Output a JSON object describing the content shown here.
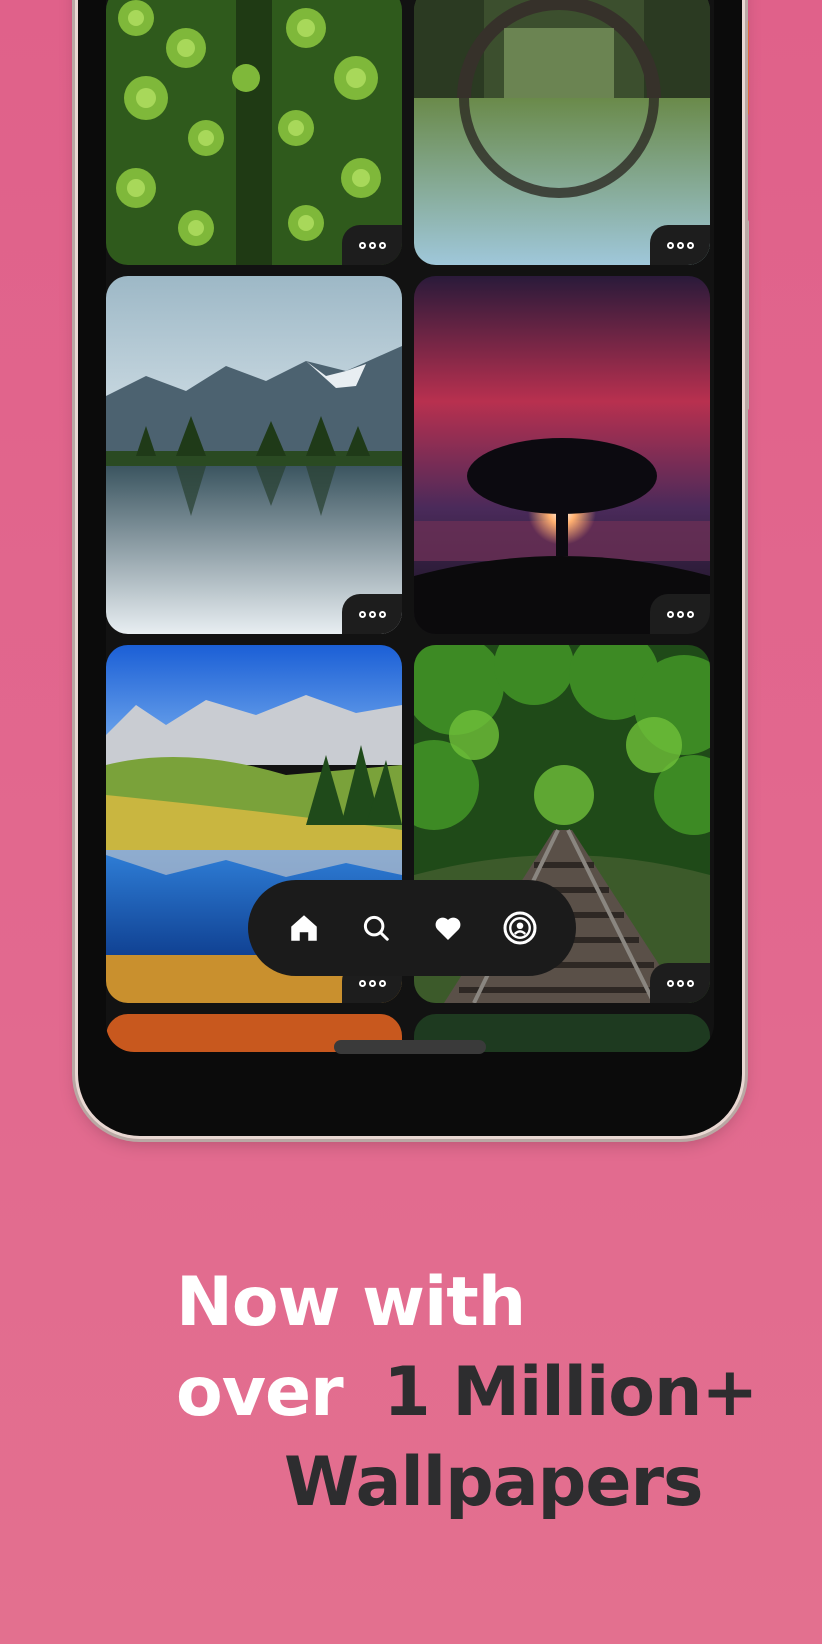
{
  "headline": {
    "line1": "Now with",
    "line2_light": "over",
    "line2_dark": "1 Million+",
    "line3": "Wallpapers"
  },
  "wallpapers": [
    {
      "subject": "pine-forest-aerial",
      "more_icon": "more-dots-icon"
    },
    {
      "subject": "stone-arch-bridge-reflection",
      "more_icon": "more-dots-icon"
    },
    {
      "subject": "mountain-lake-reflection",
      "more_icon": "more-dots-icon"
    },
    {
      "subject": "tree-sunset",
      "more_icon": "more-dots-icon"
    },
    {
      "subject": "alpine-meadow-lake",
      "more_icon": "more-dots-icon"
    },
    {
      "subject": "railway-tunnel-trees",
      "more_icon": "more-dots-icon"
    }
  ],
  "nav": {
    "items": [
      {
        "icon": "home-icon",
        "active": true
      },
      {
        "icon": "search-icon",
        "active": false
      },
      {
        "icon": "heart-icon",
        "active": false
      },
      {
        "icon": "profile-icon",
        "active": false
      }
    ]
  },
  "colors": {
    "background": "#e2668f",
    "headline_white": "#ffffff",
    "headline_dark": "#2d2d2f",
    "phone_body": "#0b0b0b",
    "nav_bar": "#1b1b1b",
    "accent_button": "#f07045"
  }
}
